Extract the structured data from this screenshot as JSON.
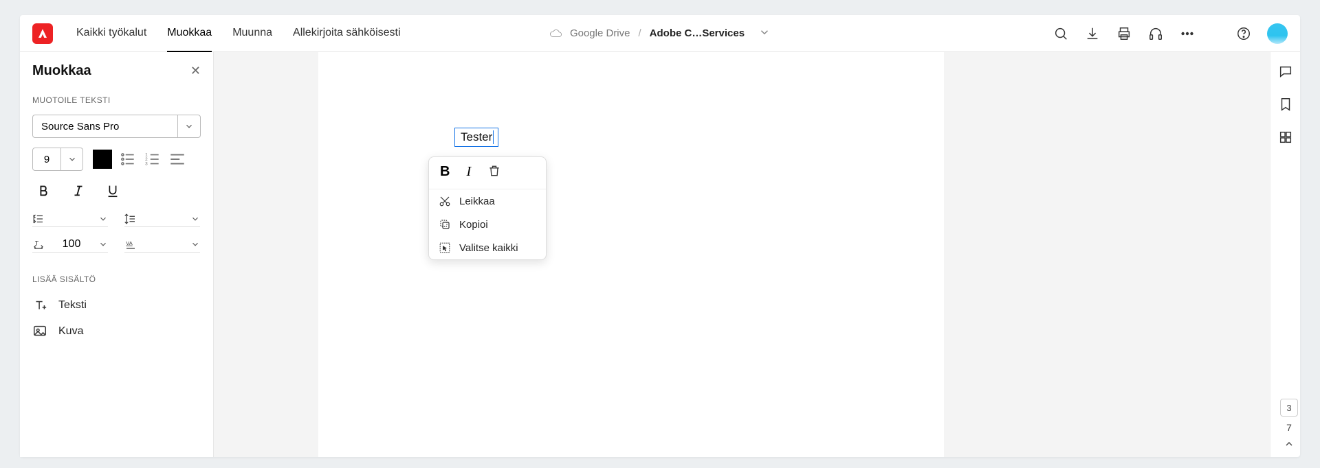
{
  "header": {
    "nav": [
      "Kaikki työkalut",
      "Muokkaa",
      "Muunna",
      "Allekirjoita sähköisesti"
    ],
    "active_nav_index": 1,
    "crumb_source": "Google Drive",
    "crumb_doc": "Adobe C…Services"
  },
  "sidebar": {
    "title": "Muokkaa",
    "section_format": "MUOTOILE TEKSTI",
    "font": "Source Sans Pro",
    "size": "9",
    "horizontal_scale": "100",
    "section_insert": "LISÄÄ SISÄLTÖ",
    "insert_text": "Teksti",
    "insert_image": "Kuva"
  },
  "document": {
    "selected_text": "Tester"
  },
  "context_menu": {
    "cut": "Leikkaa",
    "copy": "Kopioi",
    "select_all": "Valitse kaikki"
  },
  "paging": {
    "current": "3",
    "total": "7"
  }
}
